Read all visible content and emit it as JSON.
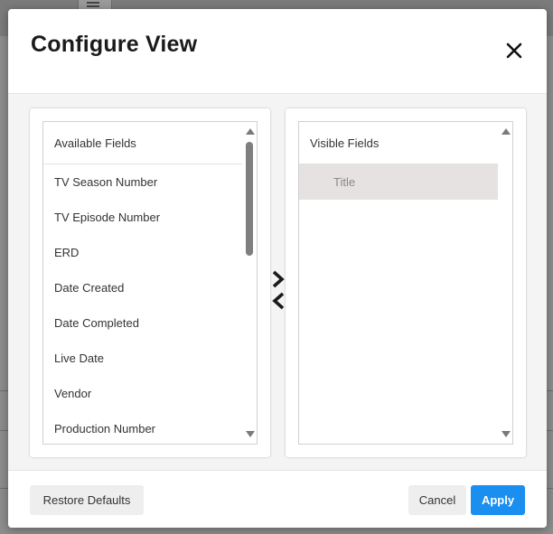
{
  "dialog": {
    "title": "Configure View",
    "close_icon": "close-icon"
  },
  "available": {
    "header": "Available Fields",
    "items": [
      "TV Season Number",
      "TV Episode Number",
      "ERD",
      "Date Created",
      "Date Completed",
      "Live Date",
      "Vendor",
      "Production Number"
    ]
  },
  "visible": {
    "header": "Visible Fields",
    "items": [
      "Title"
    ],
    "selected": "Title"
  },
  "transfer": {
    "add_icon": "chevron-right-icon",
    "remove_icon": "chevron-left-icon"
  },
  "footer": {
    "restore_label": "Restore Defaults",
    "cancel_label": "Cancel",
    "apply_label": "Apply"
  },
  "colors": {
    "primary": "#1a8ff0",
    "overlay": "#8d8d8d",
    "selected_row": "#e5e2e1"
  }
}
